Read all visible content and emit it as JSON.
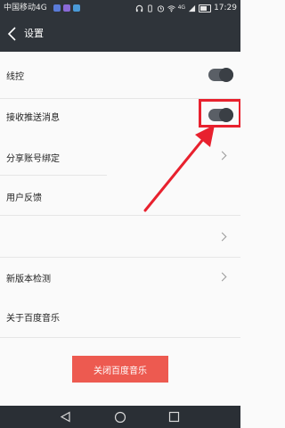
{
  "status_bar": {
    "carrier": "中国移动4G",
    "network": "4G",
    "time": "17:29"
  },
  "header": {
    "back_icon": "back-arrow-icon",
    "title": "设置"
  },
  "settings": {
    "line_control": {
      "label": "线控",
      "enabled": true
    },
    "push_messages": {
      "label": "接收推送消息",
      "enabled": true
    },
    "share_binding": {
      "label": "分享账号绑定"
    },
    "feedback": {
      "label": "用户反馈"
    },
    "unlabeled_item": {
      "label": ""
    },
    "version_check": {
      "label": "新版本检测"
    },
    "about": {
      "label": "关于百度音乐"
    }
  },
  "close_button": {
    "label": "关闭百度音乐"
  },
  "navigation": {
    "back_icon": "triangle-back-icon",
    "home_icon": "circle-home-icon",
    "recent_icon": "square-recent-icon"
  },
  "annotation": {
    "color": "#e8212e"
  },
  "colors": {
    "toolbar_bg": "#2f343a",
    "page_bg": "#fafafa",
    "accent": "#ed5a50",
    "toggle_on": "#5a5f66"
  }
}
